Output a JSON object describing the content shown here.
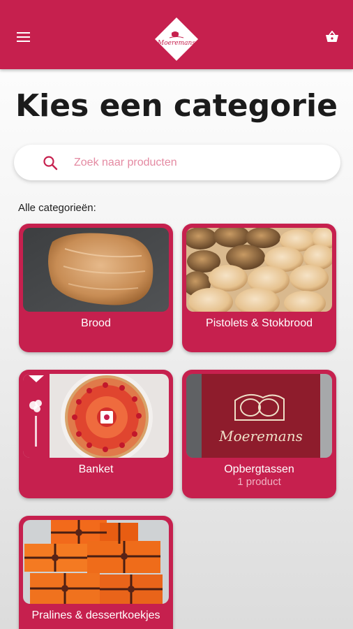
{
  "header": {
    "menu_icon": "hamburger-menu-icon",
    "cart_icon": "basket-icon",
    "logo_text": "Moeremans",
    "brand_color": "#c6204e"
  },
  "page": {
    "title": "Kies een categorie"
  },
  "search": {
    "placeholder": "Zoek naar producten",
    "icon": "search-icon"
  },
  "categories_section": {
    "label": "Alle categorieën:",
    "items": [
      {
        "label": "Brood",
        "count_label": ""
      },
      {
        "label": "Pistolets & Stokbrood",
        "count_label": ""
      },
      {
        "label": "Banket",
        "count_label": ""
      },
      {
        "label": "Opbergtassen",
        "count_label": "1 product"
      },
      {
        "label": "Pralines & dessertkoekjes",
        "count_label": ""
      }
    ]
  },
  "images": {
    "bag_brand_text": "Moeremans"
  }
}
